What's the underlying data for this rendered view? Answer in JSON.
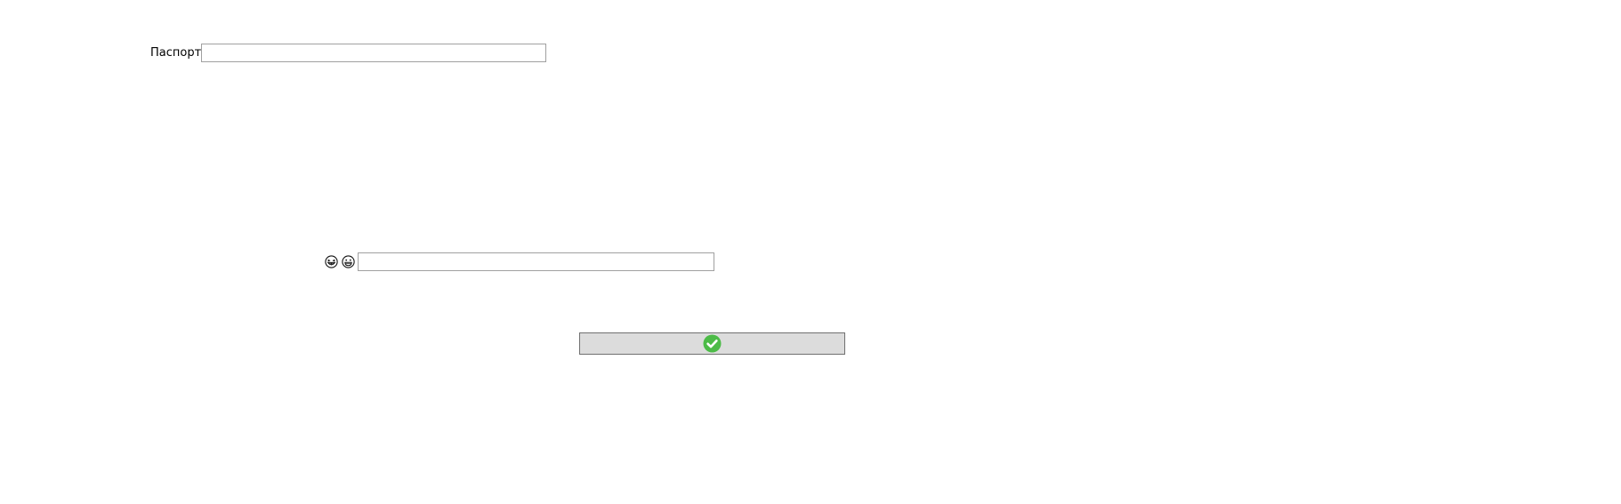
{
  "passport": {
    "label": "Паспорт",
    "value": "",
    "placeholder": ""
  },
  "smileys": {
    "first_icon": "grinning-squint-smiley-icon",
    "second_icon": "grinning-smiley-icon"
  },
  "smiley_field": {
    "value": "",
    "placeholder": ""
  },
  "confirm_button": {
    "icon": "check-circle-icon",
    "icon_color": "#4cbb47"
  }
}
